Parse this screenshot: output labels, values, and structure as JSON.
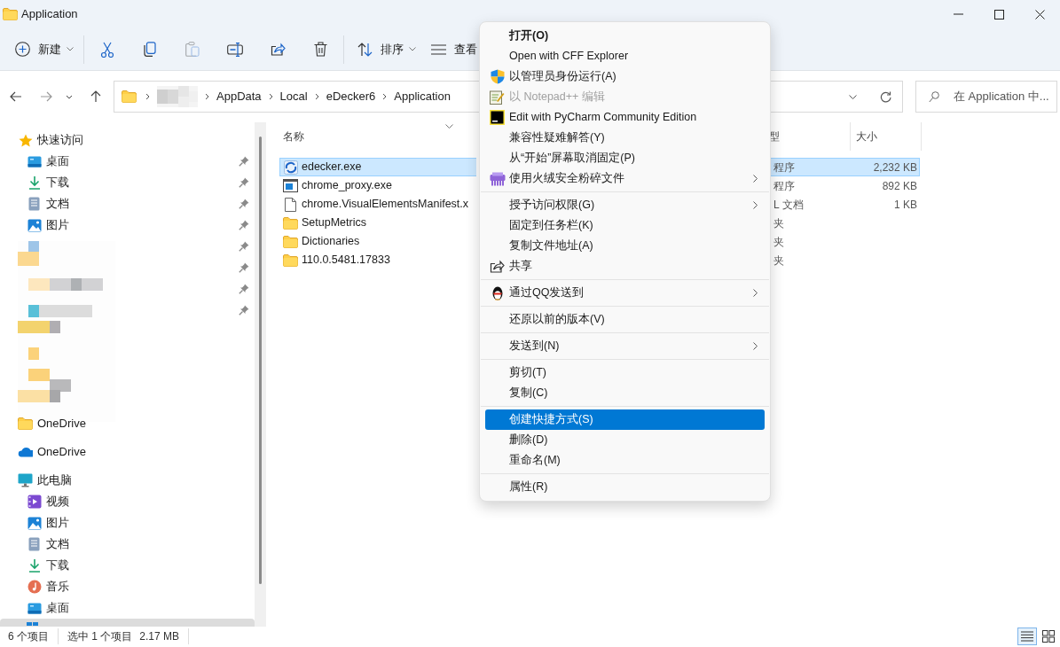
{
  "window": {
    "title": "Application"
  },
  "toolbar": [
    {
      "kind": "new",
      "label": "新建",
      "dropdown": true,
      "disabled": false
    },
    {
      "kind": "cut",
      "dropdown": false,
      "disabled": false
    },
    {
      "kind": "copy",
      "dropdown": false,
      "disabled": false
    },
    {
      "kind": "paste",
      "dropdown": false,
      "disabled": true
    },
    {
      "kind": "rename",
      "dropdown": false,
      "disabled": false
    },
    {
      "kind": "share",
      "dropdown": false,
      "disabled": false
    },
    {
      "kind": "delete",
      "dropdown": false,
      "disabled": false
    },
    {
      "kind": "sort",
      "label": "排序",
      "dropdown": true,
      "disabled": false
    },
    {
      "kind": "view",
      "label": "查看",
      "dropdown": false,
      "disabled": false
    }
  ],
  "address": {
    "crumbs": [
      "AppData",
      "Local",
      "eDecker6",
      "Application"
    ]
  },
  "search": {
    "placeholder": "在 Application 中..."
  },
  "sidebar": {
    "items": [
      {
        "kind": "star",
        "label": "快速访问",
        "children": [
          {
            "kind": "desktop",
            "label": "桌面",
            "pinned": true
          },
          {
            "kind": "download",
            "label": "下载",
            "pinned": true
          },
          {
            "kind": "document",
            "label": "文档",
            "pinned": true
          },
          {
            "kind": "pictures",
            "label": "图片",
            "pinned": true
          },
          {
            "kind": "hidden",
            "pinned": true
          },
          {
            "kind": "hidden",
            "pinned": true
          },
          {
            "kind": "hidden",
            "pinned": true
          },
          {
            "kind": "hidden",
            "pinned": true
          }
        ]
      },
      {
        "kind": "picture"
      },
      {
        "kind": "folder",
        "label": "OneDrive"
      },
      {
        "kind": "cloud",
        "label": "OneDrive"
      },
      {
        "kind": "pc",
        "label": "此电脑",
        "children": [
          {
            "kind": "video",
            "label": "视频",
            "pinned": false
          },
          {
            "kind": "pictures",
            "label": "图片",
            "pinned": false
          },
          {
            "kind": "document",
            "label": "文档",
            "pinned": false
          },
          {
            "kind": "download",
            "label": "下载",
            "pinned": false
          },
          {
            "kind": "music",
            "label": "音乐",
            "pinned": false
          },
          {
            "kind": "desktop",
            "label": "桌面",
            "pinned": false
          },
          {
            "kind": "drive",
            "selected": true
          }
        ]
      }
    ]
  },
  "files": {
    "columns": [
      "名称",
      "型",
      "大小"
    ],
    "rows": [
      {
        "kind": "exe",
        "name": "edecker.exe",
        "type": "程序",
        "size": "2,232 KB",
        "selected": true
      },
      {
        "kind": "app",
        "name": "chrome_proxy.exe",
        "type": "程序",
        "size": "892 KB",
        "selected": false
      },
      {
        "kind": "file",
        "name": "chrome.VisualElementsManifest.x",
        "type": "L 文档",
        "size": "1 KB",
        "selected": false
      },
      {
        "kind": "folder",
        "name": "SetupMetrics",
        "type": "夹",
        "selected": false
      },
      {
        "kind": "folder",
        "name": "Dictionaries",
        "type": "夹",
        "selected": false
      },
      {
        "kind": "folder",
        "name": "110.0.5481.17833",
        "type": "夹",
        "selected": false
      }
    ]
  },
  "context_menu": [
    {
      "kind": "plain",
      "label": "打开(O)",
      "bold": true,
      "disabled": false,
      "submenu": false,
      "selected": false
    },
    {
      "kind": "plain",
      "label": "Open with CFF Explorer",
      "bold": false,
      "disabled": false,
      "submenu": false,
      "selected": false
    },
    {
      "kind": "shield",
      "label": "以管理员身份运行(A)",
      "bold": false,
      "disabled": false,
      "submenu": false,
      "selected": false
    },
    {
      "kind": "notepad",
      "label": "以 Notepad++ 编辑",
      "bold": false,
      "disabled": true,
      "submenu": false,
      "selected": false
    },
    {
      "kind": "pycharm",
      "label": "Edit with PyCharm Community Edition",
      "bold": false,
      "disabled": false,
      "submenu": false,
      "selected": false
    },
    {
      "kind": "plain",
      "label": "兼容性疑难解答(Y)",
      "bold": false,
      "disabled": false,
      "submenu": false,
      "selected": false
    },
    {
      "kind": "plain",
      "label": "从“开始”屏幕取消固定(P)",
      "bold": false,
      "disabled": false,
      "submenu": false,
      "selected": false
    },
    {
      "kind": "shredder",
      "label": "使用火绒安全粉碎文件",
      "bold": false,
      "disabled": false,
      "submenu": true,
      "selected": false
    },
    {
      "kind": "separator"
    },
    {
      "kind": "plain",
      "label": "授予访问权限(G)",
      "bold": false,
      "disabled": false,
      "submenu": true,
      "selected": false
    },
    {
      "kind": "plain",
      "label": "固定到任务栏(K)",
      "bold": false,
      "disabled": false,
      "submenu": false,
      "selected": false
    },
    {
      "kind": "plain",
      "label": "复制文件地址(A)",
      "bold": false,
      "disabled": false,
      "submenu": false,
      "selected": false
    },
    {
      "kind": "share",
      "label": "共享",
      "bold": false,
      "disabled": false,
      "submenu": false,
      "selected": false
    },
    {
      "kind": "separator"
    },
    {
      "kind": "penguin",
      "label": "通过QQ发送到",
      "bold": false,
      "disabled": false,
      "submenu": true,
      "selected": false
    },
    {
      "kind": "separator"
    },
    {
      "kind": "plain",
      "label": "还原以前的版本(V)",
      "bold": false,
      "disabled": false,
      "submenu": false,
      "selected": false
    },
    {
      "kind": "separator"
    },
    {
      "kind": "plain",
      "label": "发送到(N)",
      "bold": false,
      "disabled": false,
      "submenu": true,
      "selected": false
    },
    {
      "kind": "separator"
    },
    {
      "kind": "plain",
      "label": "剪切(T)",
      "bold": false,
      "disabled": false,
      "submenu": false,
      "selected": false
    },
    {
      "kind": "plain",
      "label": "复制(C)",
      "bold": false,
      "disabled": false,
      "submenu": false,
      "selected": false
    },
    {
      "kind": "separator"
    },
    {
      "kind": "plain",
      "label": "创建快捷方式(S)",
      "bold": false,
      "disabled": false,
      "submenu": false,
      "selected": true
    },
    {
      "kind": "plain",
      "label": "删除(D)",
      "bold": false,
      "disabled": false,
      "submenu": false,
      "selected": false
    },
    {
      "kind": "plain",
      "label": "重命名(M)",
      "bold": false,
      "disabled": false,
      "submenu": false,
      "selected": false
    },
    {
      "kind": "separator"
    },
    {
      "kind": "plain",
      "label": "属性(R)",
      "bold": false,
      "disabled": false,
      "submenu": false,
      "selected": false
    }
  ],
  "status_bar": {
    "count": "6 个项目",
    "selection": "选中 1 个项目",
    "size": "2.17 MB",
    "views": [
      {
        "kind": "details",
        "selected": true
      },
      {
        "kind": "tiles",
        "selected": false
      }
    ]
  }
}
